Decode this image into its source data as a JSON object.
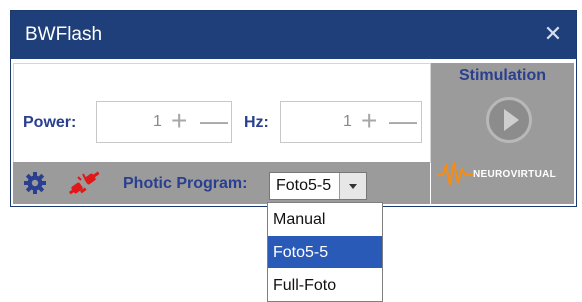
{
  "window": {
    "title": "BWFlash",
    "close_icon": "close-icon"
  },
  "controls": {
    "power_label": "Power:",
    "power_value": "1",
    "hz_label": "Hz:",
    "hz_value": "1",
    "plus_icon": "+",
    "minus_icon": "—"
  },
  "stimulation": {
    "title": "Stimulation",
    "play_icon": "play-icon",
    "brand": "NEUROVIRTUAL"
  },
  "bottom": {
    "settings_icon": "gear-icon",
    "disconnect_icon": "disconnected-plug-icon",
    "program_label": "Photic Program:",
    "program_value": "Foto5-5"
  },
  "dropdown": {
    "options": [
      "Manual",
      "Foto5-5",
      "Full-Foto"
    ],
    "selected": "Foto5-5"
  },
  "colors": {
    "titlebar": "#1f3f7a",
    "label_blue": "#2a3f8f",
    "panel_gray": "#9b9b9b",
    "selection_blue": "#2a5ab7",
    "brand_orange": "#f28c1b",
    "disconnect_red": "#e01818"
  }
}
